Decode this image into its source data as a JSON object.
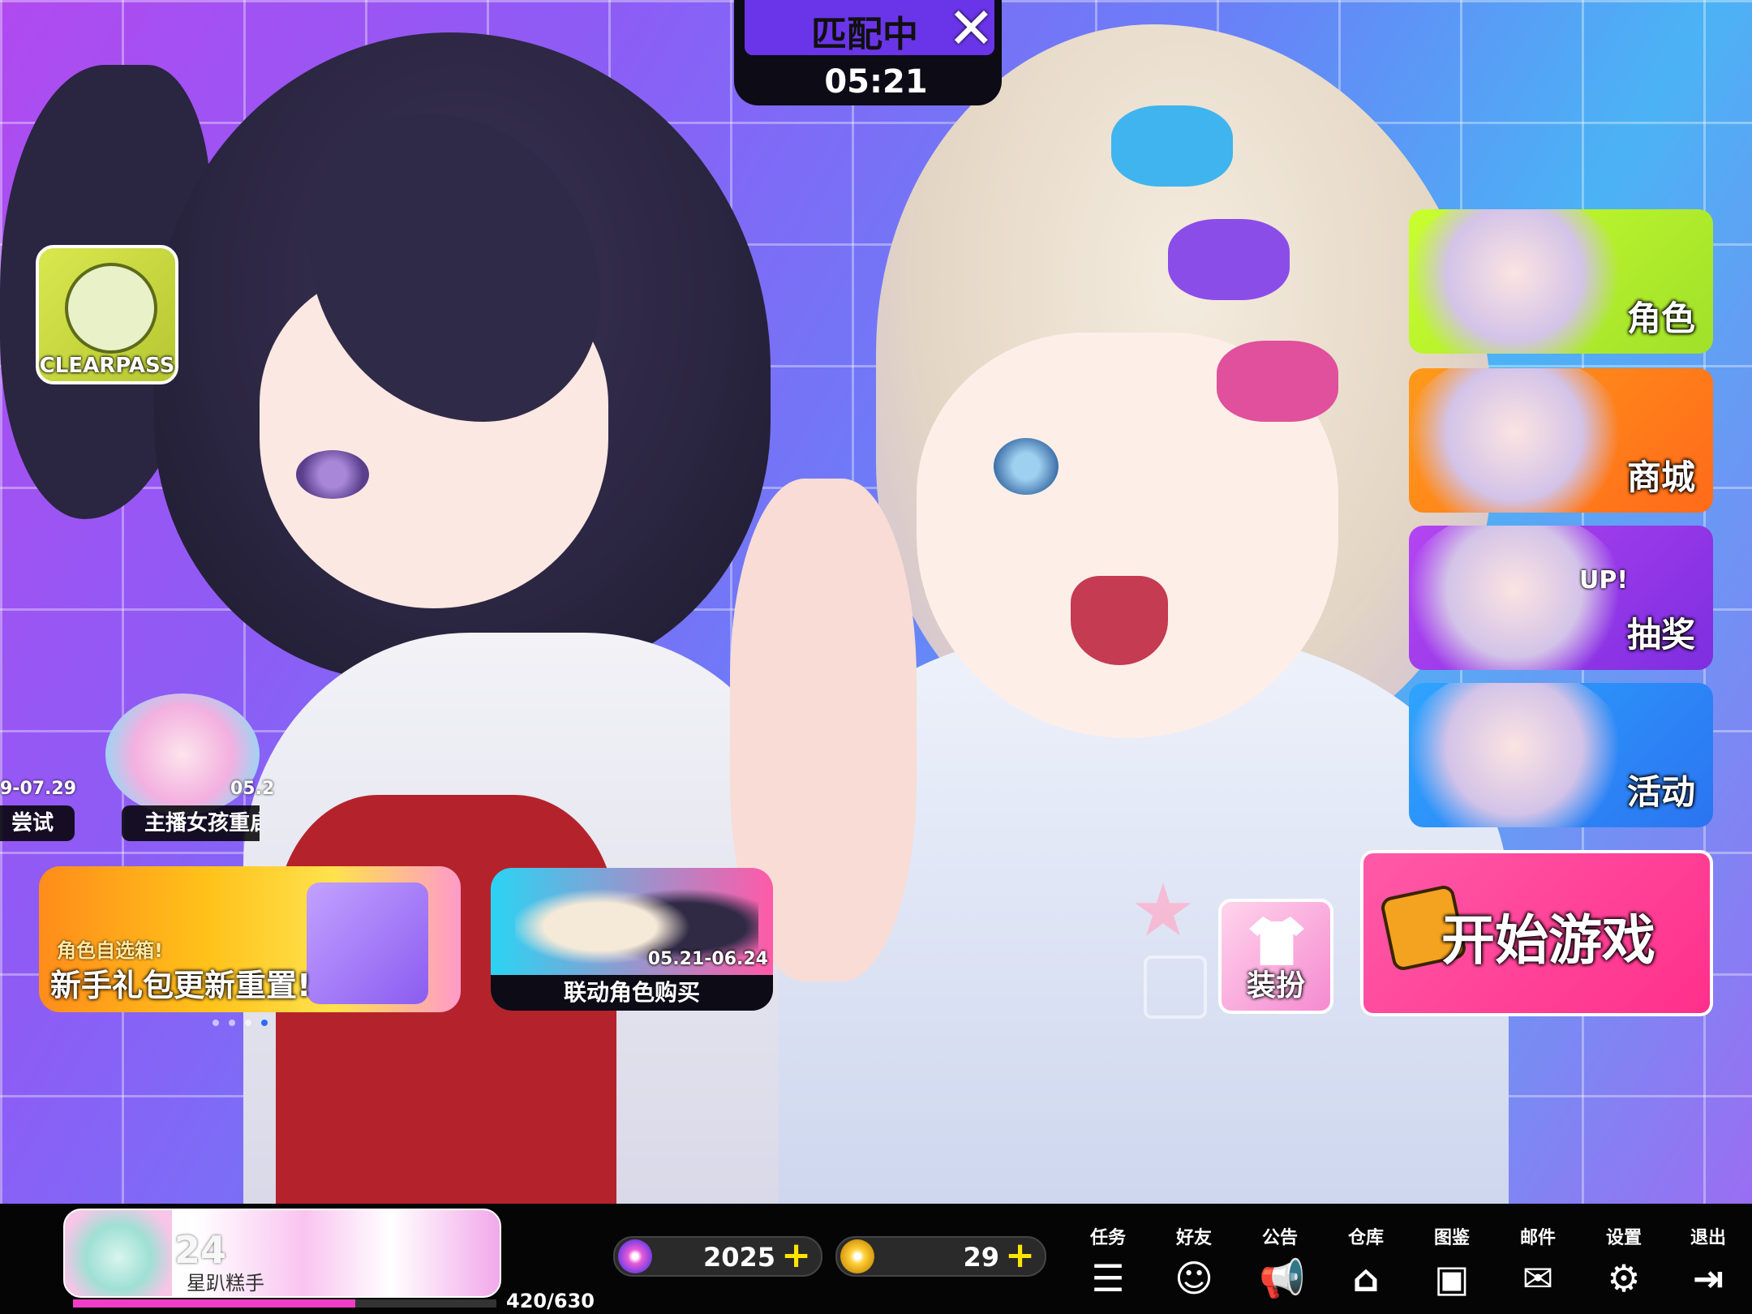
{
  "match": {
    "label": "匹配中",
    "close_glyph": "✕",
    "timer": "05:21"
  },
  "clearpass": {
    "label": "CLEARPASS"
  },
  "menu": {
    "role": "角色",
    "shop": "商城",
    "gacha": "抽奖",
    "gacha_badge": "UP!",
    "event": "活动"
  },
  "start": {
    "label": "开始游戏"
  },
  "dress": {
    "label": "装扮"
  },
  "events": {
    "trial_date": "9-07.29",
    "trial_label": "尝试",
    "streamer_date": "05.2",
    "streamer_label": "主播女孩重启"
  },
  "banner_gift": {
    "tag": "角色自选箱!",
    "title": "新手礼包更新重置!",
    "page_count": 4,
    "active_page": 4
  },
  "banner_collab": {
    "date": "05.21-06.24",
    "title": "联动角色购买"
  },
  "profile": {
    "level": "24",
    "name": "星趴糕手",
    "xp_text": "420/630",
    "xp_fraction": 0.667
  },
  "currency": {
    "disc_value": "2025",
    "gold_value": "29",
    "plus": "+"
  },
  "nav": [
    {
      "label": "任务",
      "icon": "task-icon",
      "glyph": "☰"
    },
    {
      "label": "好友",
      "icon": "friends-icon",
      "glyph": "☺"
    },
    {
      "label": "公告",
      "icon": "announcement-icon",
      "glyph": "📢"
    },
    {
      "label": "仓库",
      "icon": "warehouse-icon",
      "glyph": "⌂"
    },
    {
      "label": "图鉴",
      "icon": "collection-icon",
      "glyph": "▣"
    },
    {
      "label": "邮件",
      "icon": "mail-icon",
      "glyph": "✉"
    },
    {
      "label": "设置",
      "icon": "gear-icon",
      "glyph": "⚙"
    },
    {
      "label": "退出",
      "icon": "exit-icon",
      "glyph": "⇥"
    }
  ],
  "colors": {
    "accent_pink": "#ff2f8a",
    "match_purple": "#6a35e8",
    "xp_fill": "#f03cc6",
    "plus_yellow": "#ffe400"
  }
}
